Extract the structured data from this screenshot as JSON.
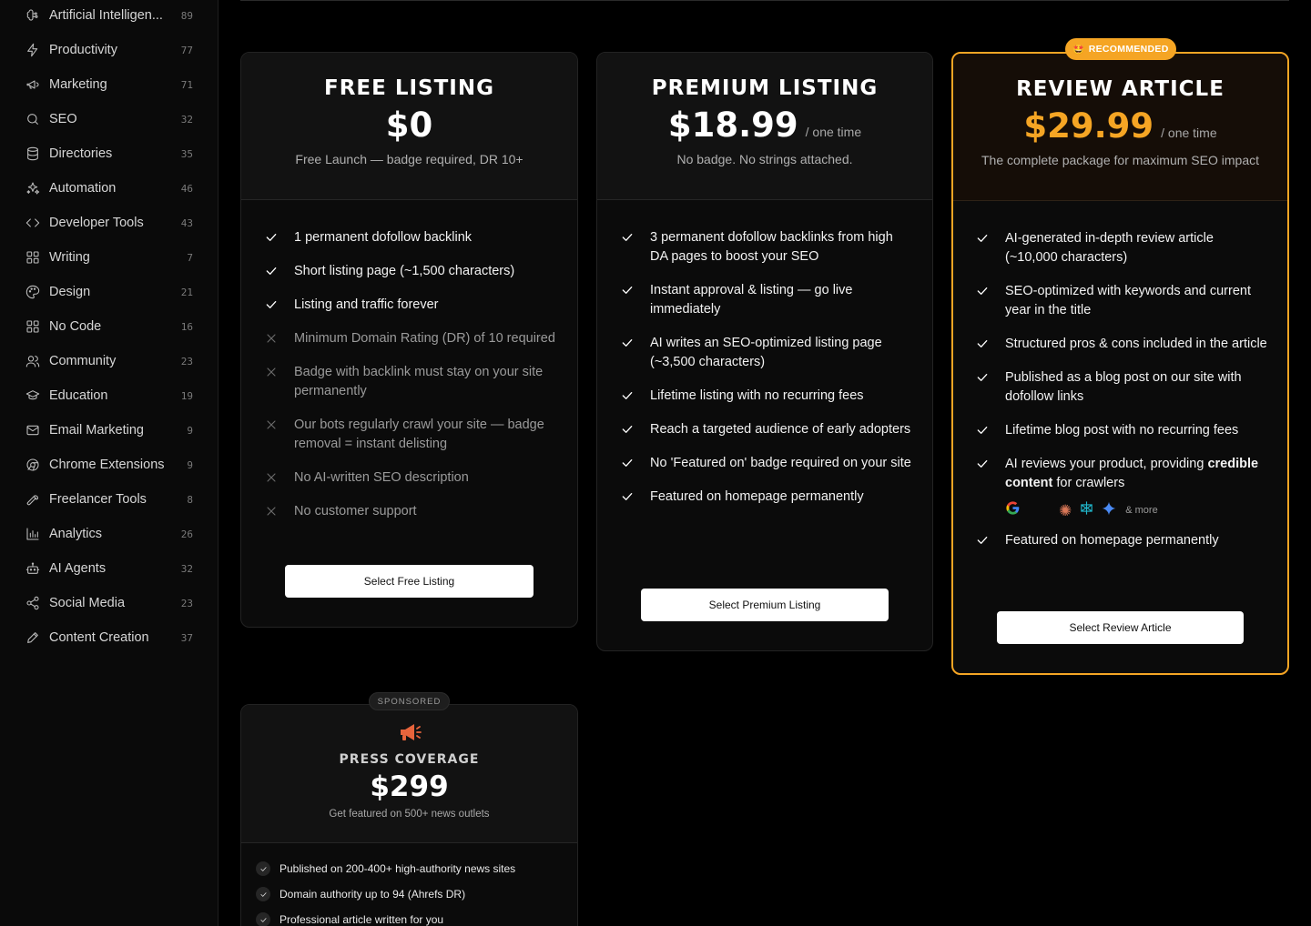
{
  "sidebar": {
    "items": [
      {
        "label": "Artificial Intelligen...",
        "count": "89",
        "icon": "brain-icon"
      },
      {
        "label": "Productivity",
        "count": "77",
        "icon": "zap-icon"
      },
      {
        "label": "Marketing",
        "count": "71",
        "icon": "megaphone-icon"
      },
      {
        "label": "SEO",
        "count": "32",
        "icon": "search-icon"
      },
      {
        "label": "Directories",
        "count": "35",
        "icon": "database-icon"
      },
      {
        "label": "Automation",
        "count": "46",
        "icon": "sparkles-icon"
      },
      {
        "label": "Developer Tools",
        "count": "43",
        "icon": "code-icon"
      },
      {
        "label": "Writing",
        "count": "7",
        "icon": "grid-icon"
      },
      {
        "label": "Design",
        "count": "21",
        "icon": "palette-icon"
      },
      {
        "label": "No Code",
        "count": "16",
        "icon": "grid-icon"
      },
      {
        "label": "Community",
        "count": "23",
        "icon": "users-icon"
      },
      {
        "label": "Education",
        "count": "19",
        "icon": "graduation-cap-icon"
      },
      {
        "label": "Email Marketing",
        "count": "9",
        "icon": "mail-icon"
      },
      {
        "label": "Chrome Extensions",
        "count": "9",
        "icon": "chrome-icon"
      },
      {
        "label": "Freelancer Tools",
        "count": "8",
        "icon": "wrench-icon"
      },
      {
        "label": "Analytics",
        "count": "26",
        "icon": "bar-chart-icon"
      },
      {
        "label": "AI Agents",
        "count": "32",
        "icon": "bot-icon"
      },
      {
        "label": "Social Media",
        "count": "23",
        "icon": "share-icon"
      },
      {
        "label": "Content Creation",
        "count": "37",
        "icon": "pencil-icon"
      }
    ]
  },
  "free": {
    "title": "FREE LISTING",
    "price": "$0",
    "subtitle": "Free Launch — badge required, DR 10+",
    "features": [
      {
        "text": "1 permanent dofollow backlink",
        "included": true
      },
      {
        "text": "Short listing page (~1,500 characters)",
        "included": true
      },
      {
        "text": "Listing and traffic forever",
        "included": true
      },
      {
        "text": "Minimum Domain Rating (DR) of 10 required",
        "included": false
      },
      {
        "text": "Badge with backlink must stay on your site permanently",
        "included": false
      },
      {
        "text": "Our bots regularly crawl your site — badge removal = instant delisting",
        "included": false
      },
      {
        "text": "No AI-written SEO description",
        "included": false
      },
      {
        "text": "No customer support",
        "included": false
      }
    ],
    "button": "Select Free Listing"
  },
  "premium": {
    "title": "PREMIUM LISTING",
    "price": "$18.99",
    "per": "/ one time",
    "subtitle": "No badge. No strings attached.",
    "features": [
      "3 permanent dofollow backlinks from high DA pages to boost your SEO",
      "Instant approval & listing — go live immediately",
      "AI writes an SEO-optimized listing page (~3,500 characters)",
      "Lifetime listing with no recurring fees",
      "Reach a targeted audience of early adopters",
      "No 'Featured on' badge required on your site",
      "Featured on homepage permanently"
    ],
    "button": "Select Premium Listing"
  },
  "review": {
    "badge": "RECOMMENDED",
    "badge_emoji": "🤩",
    "title": "REVIEW ARTICLE",
    "price": "$29.99",
    "per": "/ one time",
    "subtitle": "The complete package for maximum SEO impact",
    "features": [
      "AI-generated in-depth review article (~10,000 characters)",
      "SEO-optimized with keywords and current year in the title",
      "Structured pros & cons included in the article",
      "Published as a blog post on our site with dofollow links",
      "Lifetime blog post with no recurring fees"
    ],
    "credible_pre": "AI reviews your product, providing ",
    "credible_bold": "credible content",
    "credible_post": " for crawlers",
    "logos_more": "& more",
    "last_feature": "Featured on homepage permanently",
    "button": "Select Review Article",
    "accent": "#f5a524"
  },
  "press": {
    "badge": "SPONSORED",
    "title": "PRESS COVERAGE",
    "price": "$299",
    "subtitle": "Get featured on 500+ news outlets",
    "features": [
      "Published on 200-400+ high-authority news sites",
      "Domain authority up to 94 (Ahrefs DR)",
      "Professional article written for you"
    ],
    "icon_color": "#e8643c"
  }
}
